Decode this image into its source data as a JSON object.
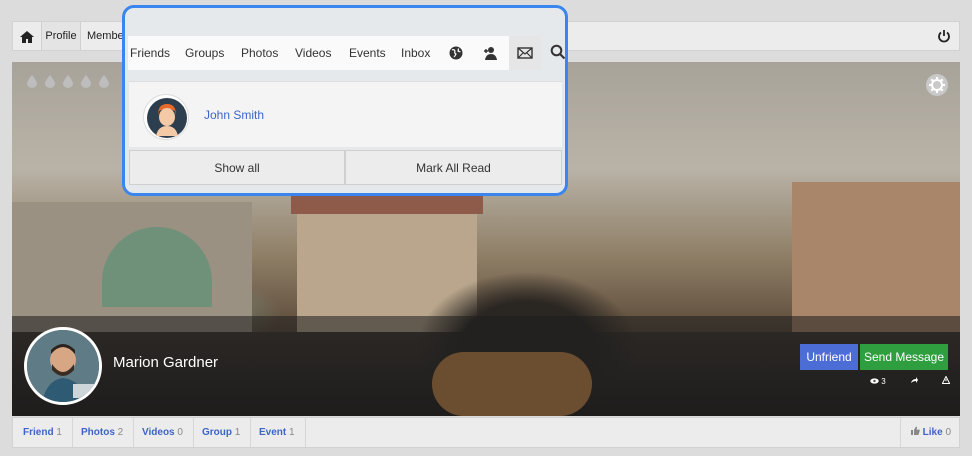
{
  "topbar": {
    "profile_label": "Profile",
    "members_label": "Member"
  },
  "cover": {
    "user_name": "Marion Gardner",
    "unfriend_label": "Unfriend",
    "send_message_label": "Send Message",
    "mini_counts": [
      "3",
      "",
      ""
    ]
  },
  "stats": {
    "friend_label": "Friend",
    "friend_count": "1",
    "photos_label": "Photos",
    "photos_count": "2",
    "videos_label": "Videos",
    "videos_count": "0",
    "group_label": "Group",
    "group_count": "1",
    "event_label": "Event",
    "event_count": "1",
    "like_label": "Like",
    "like_count": "0"
  },
  "popup": {
    "nav": {
      "friends": "Friends",
      "groups": "Groups",
      "photos": "Photos",
      "videos": "Videos",
      "events": "Events",
      "inbox": "Inbox"
    },
    "notification_name": "John Smith",
    "show_all_label": "Show all",
    "mark_all_read_label": "Mark All Read"
  },
  "colors": {
    "accent_blue": "#3e64c7",
    "highlight_border": "#3a86ee",
    "unfriend_bg": "#4d6dd6",
    "send_bg": "#2f9e3e"
  }
}
